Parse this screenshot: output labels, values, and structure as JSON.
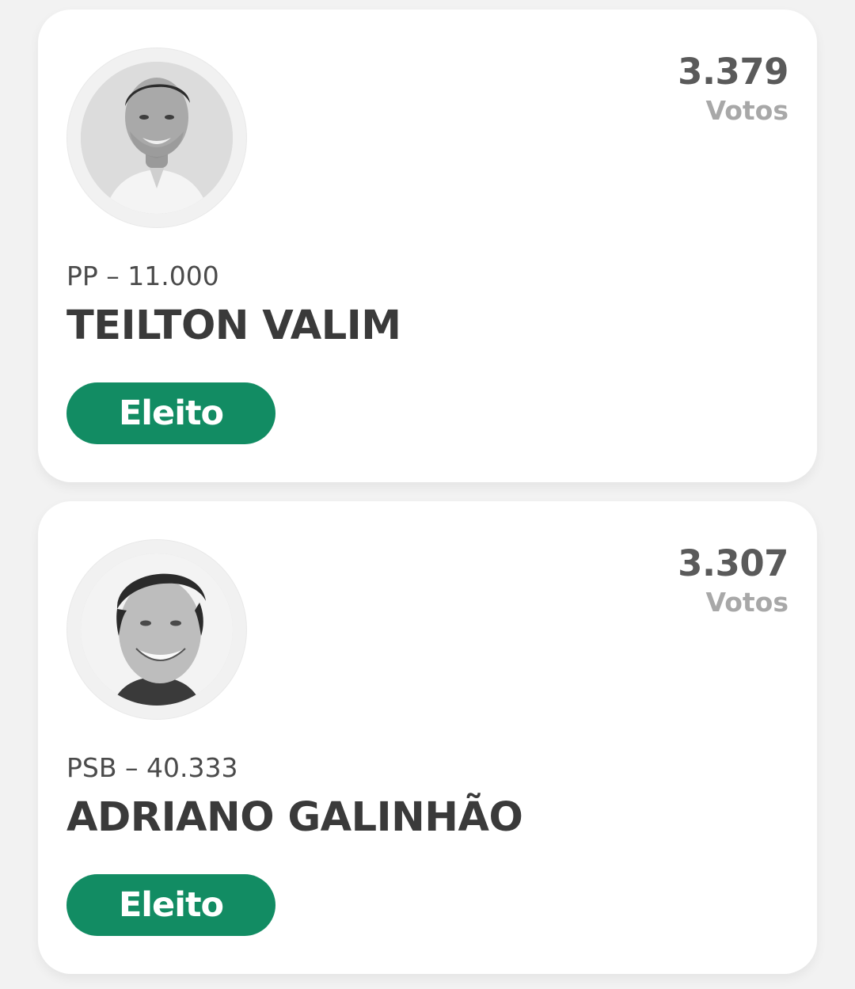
{
  "candidates": [
    {
      "photo": "candidate-photo-grayscale",
      "votes_count": "3.379",
      "votes_label": "Votos",
      "party_number": "PP – 11.000",
      "name": "TEILTON VALIM",
      "status": "Eleito"
    },
    {
      "photo": "candidate-photo-grayscale",
      "votes_count": "3.307",
      "votes_label": "Votos",
      "party_number": "PSB – 40.333",
      "name": "ADRIANO GALINHÃO",
      "status": "Eleito"
    }
  ],
  "colors": {
    "background": "#f2f2f2",
    "card": "#ffffff",
    "badge": "#128c63",
    "votes_count": "#5a5a5a",
    "votes_label": "#a8a8a8",
    "name": "#3a3a3a"
  }
}
